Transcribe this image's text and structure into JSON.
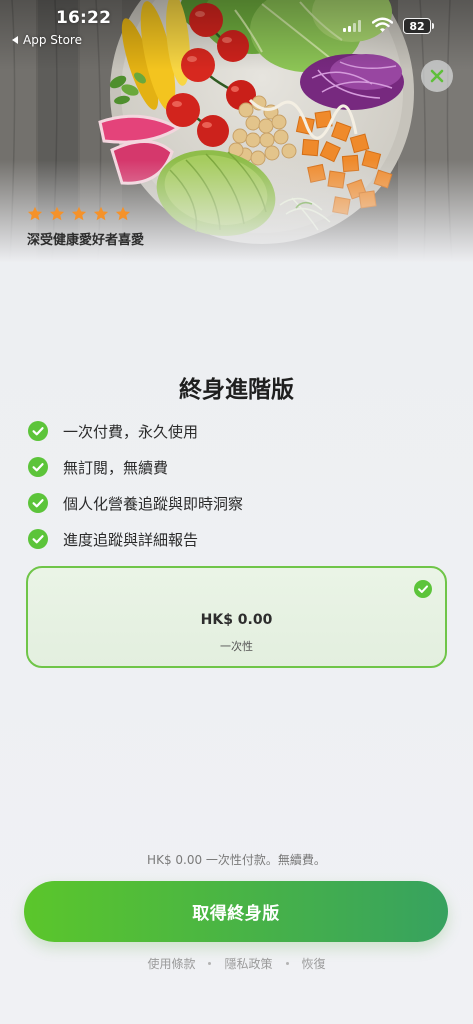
{
  "status_bar": {
    "time": "16:22",
    "back_label": "App Store",
    "back_icon": "back-triangle-icon",
    "battery_level": "82",
    "icons": [
      "cellular-signal-icon",
      "wifi-icon",
      "battery-icon"
    ]
  },
  "header": {
    "close_icon": "close-icon",
    "rating_stars": 5,
    "tagline": "深受健康愛好者喜愛"
  },
  "paywall": {
    "title": "終身進階版",
    "feature_icon": "check-circle-icon",
    "features": [
      "一次付費，永久使用",
      "無訂閱，無續費",
      "個人化營養追蹤與即時洞察",
      "進度追蹤與詳細報告"
    ],
    "plan": {
      "price": "HK$ 0.00",
      "billing": "一次性",
      "selected": true
    }
  },
  "footer": {
    "summary": "HK$ 0.00 一次性付款。無續費。",
    "cta_label": "取得終身版",
    "links": [
      "使用條款",
      "隱私政策",
      "恢復"
    ]
  },
  "colors": {
    "accent": "#5cc43a",
    "cta_gradient_start": "#5bc62b",
    "cta_gradient_end": "#37a25f",
    "star": "#f5922a",
    "background": "#edeef1"
  }
}
